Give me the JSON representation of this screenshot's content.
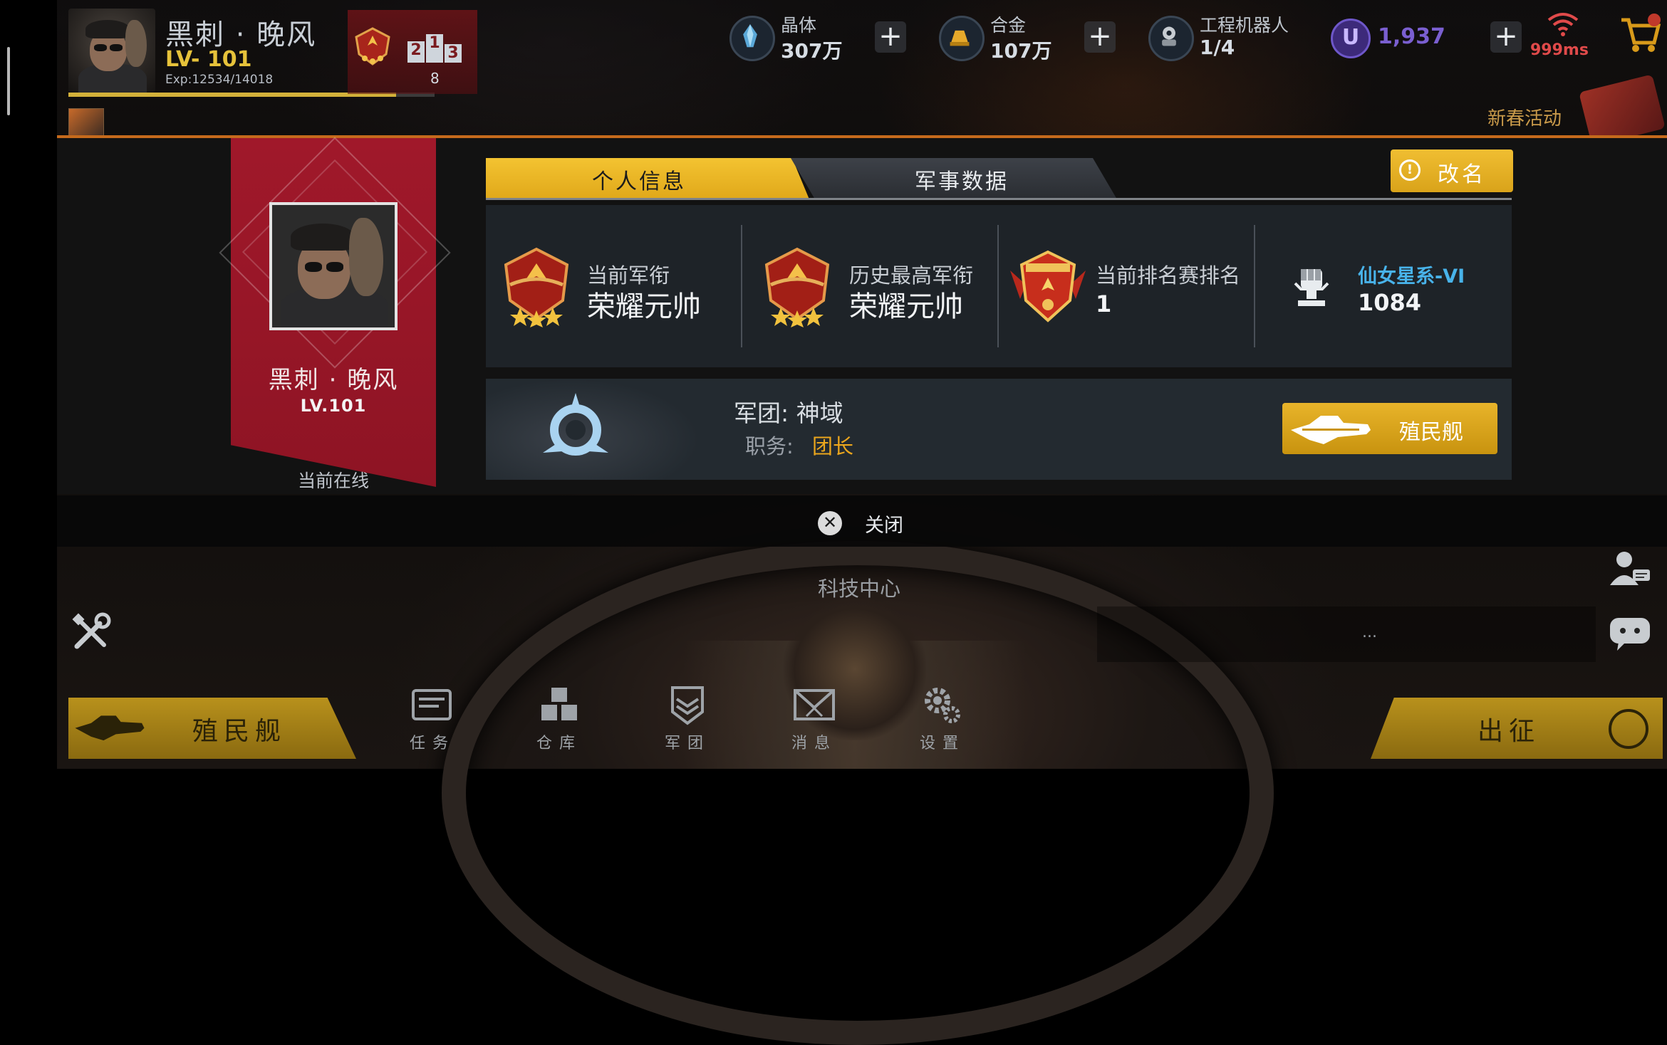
{
  "player": {
    "name": "黑刺 · 晚风",
    "level_top": "LV- 101",
    "exp": "Exp:12534/14018",
    "exp_fraction": 0.894,
    "rank_count": "8",
    "podium": [
      "2",
      "1",
      "3"
    ]
  },
  "resources": [
    {
      "label": "晶体",
      "value": "307万",
      "icon": "crystal-icon"
    },
    {
      "label": "合金",
      "value": "107万",
      "icon": "alloy-icon"
    },
    {
      "label": "工程机器人",
      "value": "1/4",
      "icon": "robot-icon"
    }
  ],
  "currency": {
    "symbol": "U",
    "value": "1,937"
  },
  "network": {
    "ping": "999ms"
  },
  "event": {
    "label": "新春活动"
  },
  "profile": {
    "banner_name": "黑刺 · 晚风",
    "banner_level": "LV.101",
    "online_status": "当前在线",
    "tabs": [
      "个人信息",
      "军事数据"
    ],
    "rename": {
      "icon": "!",
      "label": "改名"
    },
    "stats": [
      {
        "label": "当前军衔",
        "value": "荣耀元帅",
        "icon": "rank-medal-icon"
      },
      {
        "label": "历史最高军衔",
        "value": "荣耀元帅",
        "icon": "highest-rank-medal-icon"
      },
      {
        "label": "当前排名赛排名",
        "value": "1",
        "icon": "ranking-badge-icon"
      },
      {
        "label": "仙女星系-VI",
        "value": "1084",
        "icon": "fist-trophy-icon"
      }
    ],
    "legion": {
      "legion_label": "军团: 神域",
      "duty_label": "职务:",
      "duty_value": "团长",
      "ship_button": "殖民舰"
    }
  },
  "close": {
    "icon": "✕",
    "label": "关闭"
  },
  "scene": {
    "tech_center": "科技中心",
    "chat_placeholder": "..."
  },
  "bottom_nav": {
    "colony": "殖民舰",
    "deploy": "出征",
    "items": [
      "任务",
      "仓库",
      "军团",
      "消息",
      "设置"
    ]
  },
  "colors": {
    "accent_gold": "#f0be32",
    "banner_red": "#a0182a",
    "link_blue": "#48b3ea",
    "duty_orange": "#eba61d",
    "currency_purple": "#7a5fd0",
    "ping_red": "#e04a4a"
  }
}
